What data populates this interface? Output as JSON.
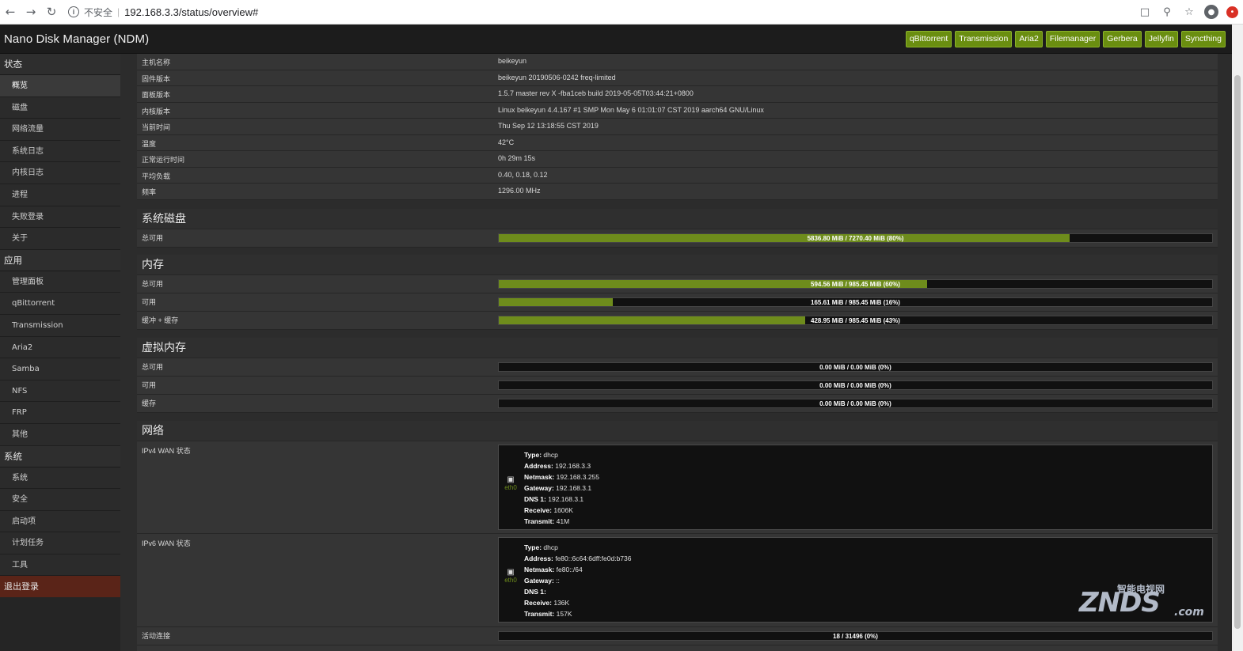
{
  "browser": {
    "security_label": "不安全",
    "url": "192.168.3.3/status/overview#"
  },
  "app": {
    "title": "Nano Disk Manager (NDM)",
    "quick_links": [
      "qBittorrent",
      "Transmission",
      "Aria2",
      "Filemanager",
      "Gerbera",
      "Jellyfin",
      "Syncthing"
    ]
  },
  "sidebar": {
    "status_label": "状态",
    "status_items": [
      "概览",
      "磁盘",
      "网络流量",
      "系统日志",
      "内核日志",
      "进程",
      "失败登录",
      "关于"
    ],
    "apps_label": "应用",
    "apps_items": [
      "管理面板",
      "qBittorrent",
      "Transmission",
      "Aria2",
      "Samba",
      "NFS",
      "FRP",
      "其他"
    ],
    "system_label": "系统",
    "system_items": [
      "系统",
      "安全",
      "启动项",
      "计划任务",
      "工具"
    ],
    "logout_label": "退出登录"
  },
  "info": [
    {
      "k": "主机名称",
      "v": "beikeyun"
    },
    {
      "k": "固件版本",
      "v": "beikeyun 20190506-0242 freq-limited"
    },
    {
      "k": "面板版本",
      "v": "1.5.7 master rev X -fba1ceb build 2019-05-05T03:44:21+0800"
    },
    {
      "k": "内核版本",
      "v": "Linux beikeyun 4.4.167 #1 SMP Mon May 6 01:01:07 CST 2019 aarch64 GNU/Linux"
    },
    {
      "k": "当前时间",
      "v": "Thu Sep 12 13:18:55 CST 2019"
    },
    {
      "k": "温度",
      "v": "42°C"
    },
    {
      "k": "正常运行时间",
      "v": "0h 29m 15s"
    },
    {
      "k": "平均负载",
      "v": "0.40, 0.18, 0.12"
    },
    {
      "k": "频率",
      "v": "1296.00 MHz"
    }
  ],
  "disk": {
    "title": "系统磁盘",
    "rows": [
      {
        "k": "总可用",
        "text": "5836.80 MiB / 7270.40 MiB (80%)",
        "pct": 80
      }
    ]
  },
  "memory": {
    "title": "内存",
    "rows": [
      {
        "k": "总可用",
        "text": "594.56 MiB / 985.45 MiB (60%)",
        "pct": 60
      },
      {
        "k": "可用",
        "text": "165.61 MiB / 985.45 MiB (16%)",
        "pct": 16
      },
      {
        "k": "缓冲 + 缓存",
        "text": "428.95 MiB / 985.45 MiB (43%)",
        "pct": 43
      }
    ]
  },
  "swap": {
    "title": "虚拟内存",
    "rows": [
      {
        "k": "总可用",
        "text": "0.00 MiB / 0.00 MiB (0%)",
        "pct": 0
      },
      {
        "k": "可用",
        "text": "0.00 MiB / 0.00 MiB (0%)",
        "pct": 0
      },
      {
        "k": "缓存",
        "text": "0.00 MiB / 0.00 MiB (0%)",
        "pct": 0
      }
    ]
  },
  "network": {
    "title": "网络",
    "ipv4": {
      "label": "IPv4 WAN 状态",
      "iface": "eth0",
      "type_k": "Type:",
      "type_v": "dhcp",
      "addr_k": "Address:",
      "addr_v": "192.168.3.3",
      "mask_k": "Netmask:",
      "mask_v": "192.168.3.255",
      "gw_k": "Gateway:",
      "gw_v": "192.168.3.1",
      "dns_k": "DNS 1:",
      "dns_v": "192.168.3.1",
      "rx_k": "Receive:",
      "rx_v": "1606K",
      "tx_k": "Transmit:",
      "tx_v": "41M"
    },
    "ipv6": {
      "label": "IPv6 WAN 状态",
      "iface": "eth0",
      "type_k": "Type:",
      "type_v": "dhcp",
      "addr_k": "Address:",
      "addr_v": "fe80::6c64:6dff:fe0d:b736",
      "mask_k": "Netmask:",
      "mask_v": "fe80::/64",
      "gw_k": "Gateway:",
      "gw_v": "::",
      "dns_k": "DNS 1:",
      "dns_v": "",
      "rx_k": "Receive:",
      "rx_v": "136K",
      "tx_k": "Transmit:",
      "tx_v": "157K"
    },
    "conn": {
      "k": "活动连接",
      "text": "18 / 31496 (0%)",
      "pct": 0
    }
  },
  "watermark": {
    "main": "ZNDS",
    "sub": "智能电视网",
    "suffix": ".com"
  }
}
